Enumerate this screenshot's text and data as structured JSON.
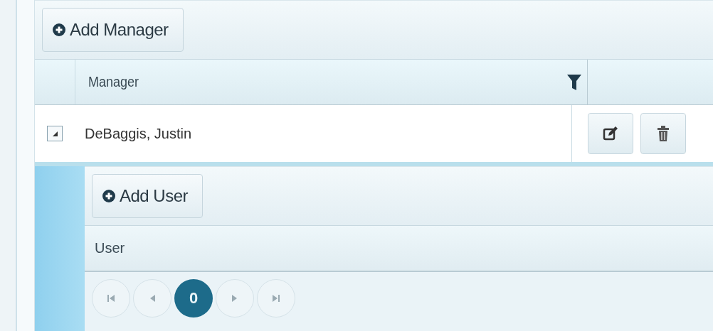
{
  "toolbar": {
    "add_button": "Add Manager"
  },
  "table": {
    "columns": [
      {
        "label": "Manager",
        "filterable": true
      }
    ],
    "rows": [
      {
        "name": "DeBaggis, Justin",
        "expanded": true
      }
    ]
  },
  "detail": {
    "toolbar": {
      "add_button": "Add User"
    },
    "columns": [
      {
        "label": "User"
      }
    ],
    "pager": {
      "pages": [
        {
          "label": "0",
          "selected": true
        }
      ]
    }
  }
}
